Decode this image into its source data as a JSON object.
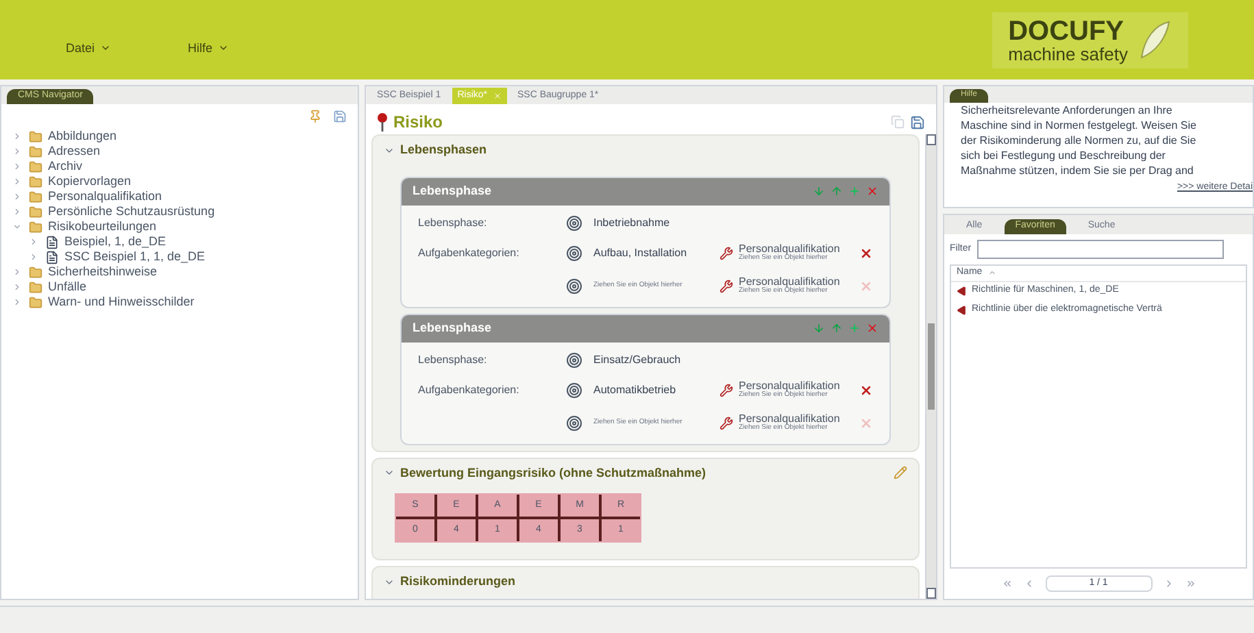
{
  "menu": [
    {
      "label": "Datei"
    },
    {
      "label": "Hilfe"
    }
  ],
  "logo": {
    "brand": "DOCUFY",
    "tagline": "machine safety"
  },
  "navigator": {
    "title": "CMS Navigator",
    "tree": [
      {
        "label": "Abbildungen",
        "kind": "folder",
        "expanded": false
      },
      {
        "label": "Adressen",
        "kind": "folder",
        "expanded": false
      },
      {
        "label": "Archiv",
        "kind": "folder",
        "expanded": false
      },
      {
        "label": "Kopiervorlagen",
        "kind": "folder",
        "expanded": false
      },
      {
        "label": "Personalqualifikation",
        "kind": "folder",
        "expanded": false
      },
      {
        "label": "Persönliche Schutzausrüstung",
        "kind": "folder",
        "expanded": false
      },
      {
        "label": "Risikobeurteilungen",
        "kind": "folder",
        "expanded": true,
        "children": [
          {
            "label": "Beispiel, 1, de_DE",
            "kind": "document",
            "expanded": false
          },
          {
            "label": "SSC Beispiel 1, 1, de_DE",
            "kind": "document",
            "expanded": false
          }
        ]
      },
      {
        "label": "Sicherheitshinweise",
        "kind": "folder",
        "expanded": false
      },
      {
        "label": "Unfälle",
        "kind": "folder",
        "expanded": false
      },
      {
        "label": "Warn- und Hinweisschilder",
        "kind": "folder",
        "expanded": false
      }
    ]
  },
  "editor": {
    "tabs": [
      {
        "label": "SSC Beispiel 1",
        "selected": false
      },
      {
        "label": "Risiko*",
        "selected": true
      },
      {
        "label": "SSC Baugruppe 1*",
        "selected": false
      }
    ],
    "title": "Risiko",
    "phases_section": {
      "title": "Lebensphasen",
      "expanded": true,
      "phases": [
        {
          "title": "Lebensphase",
          "phase_label": "Lebensphase:",
          "phase_value": "Inbetriebnahme",
          "tasks_label": "Aufgabenkategorien:",
          "tasks": [
            {
              "value": "Aufbau, Installation",
              "placeholder": false,
              "qual_title": "Personalqualifikation",
              "qual_hint": "Ziehen Sie ein Objekt hierher",
              "removable": true
            },
            {
              "value": "Ziehen Sie ein Objekt hierher",
              "placeholder": true,
              "qual_title": "Personalqualifikation",
              "qual_hint": "Ziehen Sie ein Objekt hierher",
              "removable": false
            }
          ]
        },
        {
          "title": "Lebensphase",
          "phase_label": "Lebensphase:",
          "phase_value": "Einsatz/Gebrauch",
          "tasks_label": "Aufgabenkategorien:",
          "tasks": [
            {
              "value": "Automatikbetrieb",
              "placeholder": false,
              "qual_title": "Personalqualifikation",
              "qual_hint": "Ziehen Sie ein Objekt hierher",
              "removable": true
            },
            {
              "value": "Ziehen Sie ein Objekt hierher",
              "placeholder": true,
              "qual_title": "Personalqualifikation",
              "qual_hint": "Ziehen Sie ein Objekt hierher",
              "removable": false
            }
          ]
        }
      ]
    },
    "risk_section": {
      "title": "Bewertung Eingangsrisiko (ohne Schutzmaßnahme)",
      "expanded": true,
      "headers": [
        "S",
        "E",
        "A",
        "E",
        "M",
        "R"
      ],
      "values": [
        "0",
        "4",
        "1",
        "4",
        "3",
        "1"
      ]
    },
    "reduction_section": {
      "title": "Risikominderungen",
      "expanded": true
    }
  },
  "help": {
    "title": "Hilfe",
    "lines": [
      "Sicherheitsrelevante Anforderungen an Ihre",
      "Maschine sind in Normen festgelegt. Weisen Sie",
      "der Risikominderung alle Normen zu, auf die Sie",
      "sich bei Festlegung und Beschreibung der",
      "Maßnahme stützen, indem Sie sie per Drag and"
    ],
    "link": ">>> weitere Detai"
  },
  "library": {
    "tabs": [
      {
        "label": "Alle",
        "selected": false
      },
      {
        "label": "Favoriten",
        "selected": true
      },
      {
        "label": "Suche",
        "selected": false
      }
    ],
    "filter_label": "Filter",
    "column": "Name",
    "items": [
      {
        "label": "Richtlinie für Maschinen, 1, de_DE"
      },
      {
        "label": "Richtlinie über die elektromagnetische Verträ"
      }
    ],
    "page": "1 / 1"
  }
}
